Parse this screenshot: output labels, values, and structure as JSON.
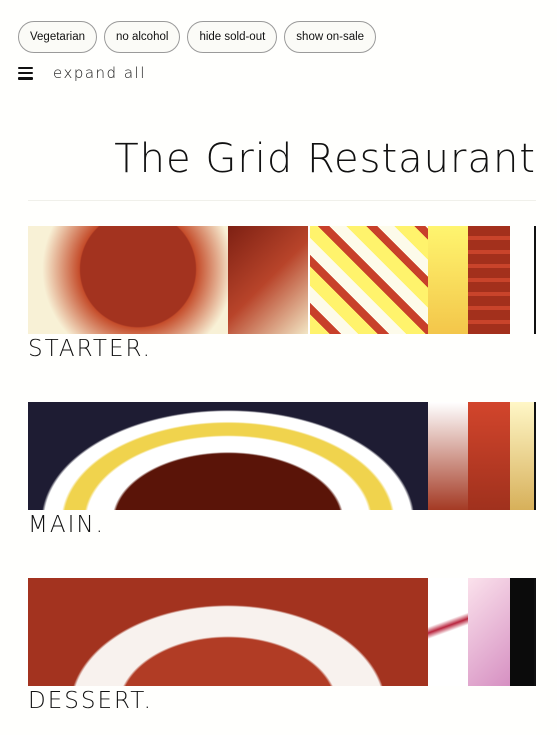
{
  "filters": [
    "Vegetarian",
    "no alcohol",
    "hide sold-out",
    "show on-sale"
  ],
  "toolbar": {
    "menu_icon": "hamburger-icon",
    "expand_label": "expand all"
  },
  "title": "The Grid Restaurant",
  "sections": [
    {
      "label": "STARTER."
    },
    {
      "label": "MAIN."
    },
    {
      "label": "DESSERT."
    }
  ]
}
